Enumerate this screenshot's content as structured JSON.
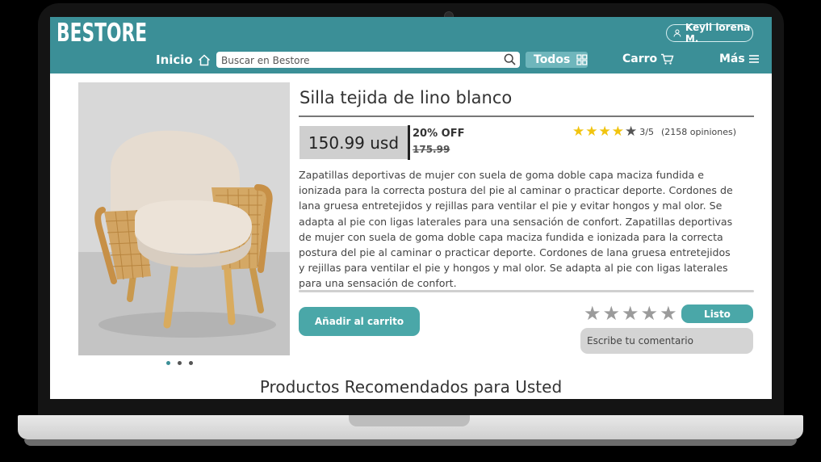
{
  "app": {
    "logo": "BESTORE",
    "user_name": "Keyli lorena M."
  },
  "nav": {
    "home_label": "Inicio",
    "search_placeholder": "Buscar en Bestore",
    "categories_label": "Todos",
    "cart_label": "Carro",
    "more_label": "Más"
  },
  "product": {
    "title": "Silla  tejida de lino blanco",
    "price": "150.99 usd",
    "discount": "20% OFF",
    "old_price": "175.99",
    "rating": {
      "stars_filled": 4,
      "stars_total": 5,
      "score_text": "3/5",
      "reviews_text": "(2158 opiniones)"
    },
    "description": "Zapatillas deportivas de mujer con suela de goma doble capa maciza fundida e ionizada para la correcta postura del pie al caminar o practicar deporte. Cordones de lana gruesa entretejidos y rejillas para ventilar el pie y evitar hongos y mal olor. Se adapta al pie con ligas laterales para una sensación de confort. Zapatillas deportivas de mujer con suela de goma doble capa maciza fundida e ionizada para la correcta postura del pie al caminar o practicar deporte. Cordones de lana gruesa entretejidos y rejillas para ventilar el pie y hongos y mal olor. Se adapta al pie con ligas laterales para una sensación de confort.",
    "add_to_cart_label": "Añadir al carrito",
    "carousel": {
      "count": 3,
      "active": 0
    }
  },
  "review": {
    "star_count": 5,
    "submit_label": "Listo",
    "comment_placeholder": "Escribe tu comentario"
  },
  "recommended": {
    "heading": "Productos Recomendados para Usted"
  },
  "colors": {
    "brand": "#3b8f97",
    "accent": "#4aa7a8",
    "star": "#f1c40f"
  }
}
